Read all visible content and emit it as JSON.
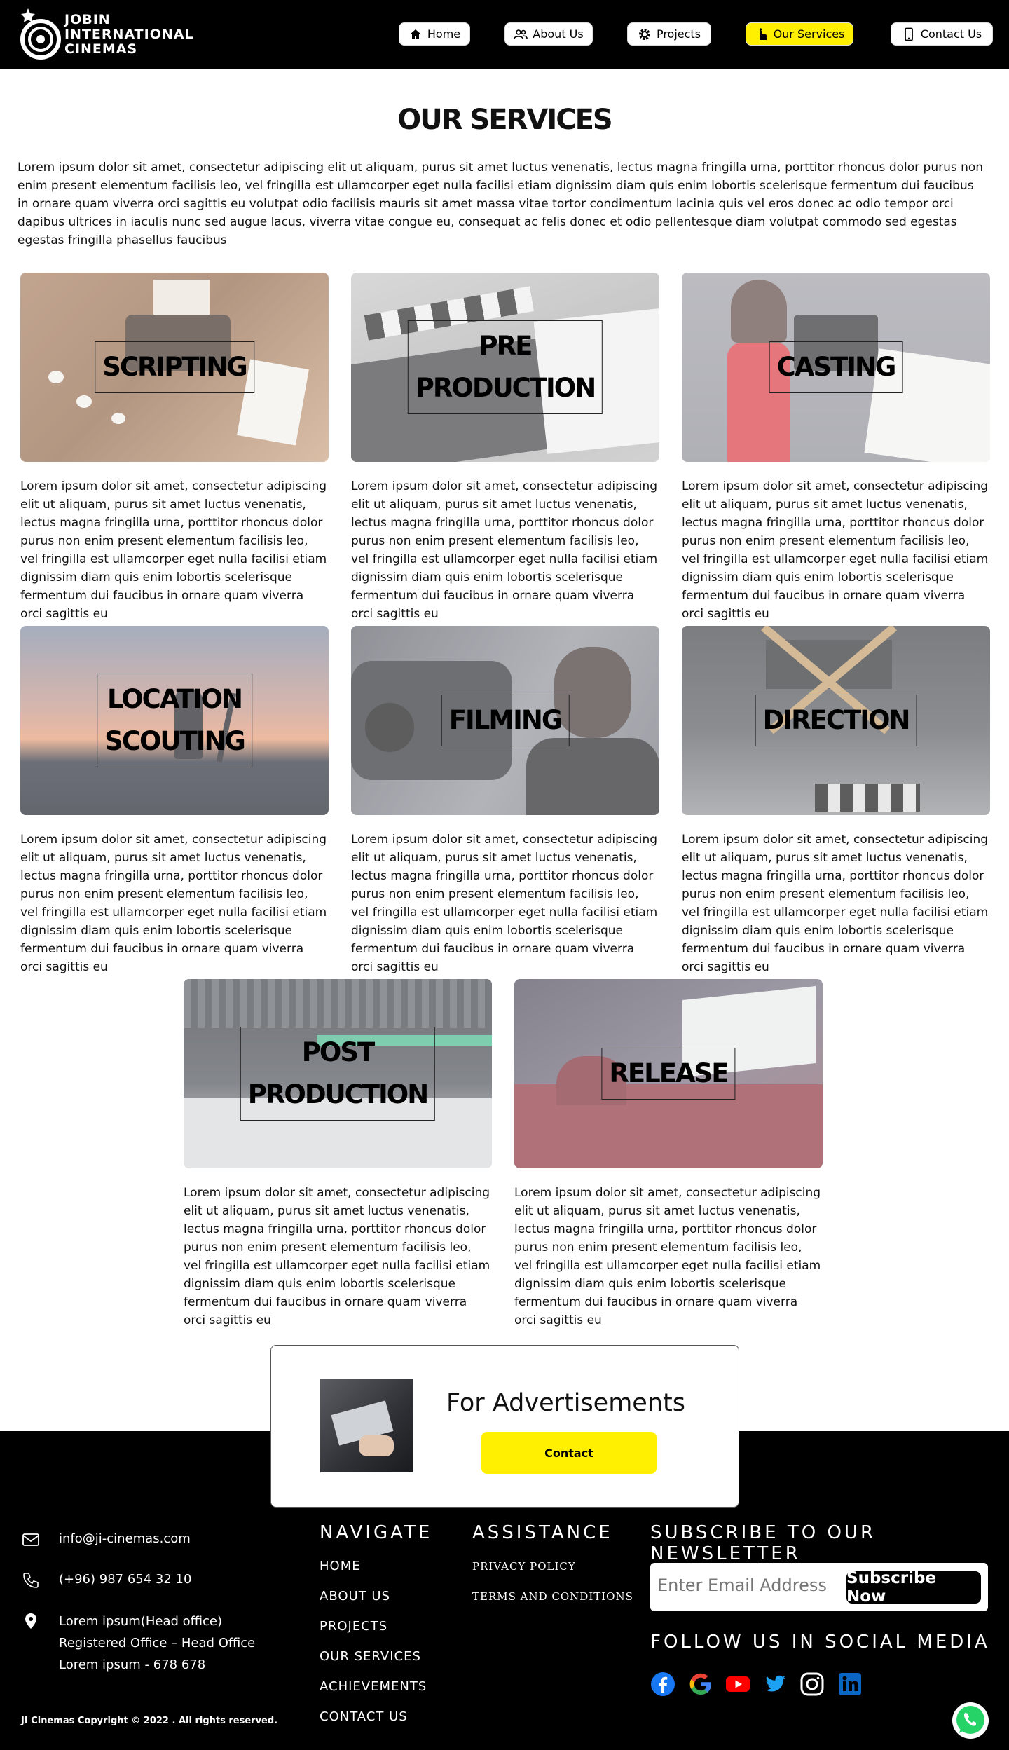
{
  "brand": {
    "lines": [
      "JOBIN",
      "INTERNATIONAL",
      "CINEMAS"
    ]
  },
  "nav": {
    "items": [
      {
        "label": "Home",
        "icon": "home-icon"
      },
      {
        "label": "About Us",
        "icon": "users-icon"
      },
      {
        "label": "Projects",
        "icon": "gear-icon"
      },
      {
        "label": "Our Services",
        "icon": "hand-icon",
        "active": true
      },
      {
        "label": "Contact Us",
        "icon": "phone-icon"
      }
    ],
    "active_color": "#ffef00"
  },
  "page": {
    "title": "OUR SERVICES",
    "intro": "Lorem ipsum dolor sit amet, consectetur adipiscing elit ut aliquam, purus sit amet luctus venenatis, lectus magna fringilla urna, porttitor rhoncus dolor purus non enim present elementum facilisis leo, vel fringilla est ullamcorper eget nulla facilisi etiam dignissim diam quis enim lobortis scelerisque fermentum dui faucibus in ornare quam viverra orci sagittis eu volutpat odio facilisis mauris sit amet massa vitae tortor condimentum lacinia quis vel eros donec ac odio tempor orci dapibus ultrices in iaculis nunc sed augue lacus, viverra vitae congue eu, consequat ac felis donec et odio pellentesque diam volutpat commodo sed egestas egestas fringilla phasellus faucibus"
  },
  "services": [
    {
      "label": "SCRIPTING",
      "text": "Lorem ipsum dolor sit amet, consectetur adipiscing elit ut aliquam, purus sit amet luctus venenatis, lectus magna fringilla urna, porttitor rhoncus dolor purus non enim present elementum facilisis leo, vel fringilla est ullamcorper eget nulla facilisi etiam dignissim diam quis enim lobortis scelerisque fermentum dui faucibus in ornare quam viverra orci sagittis eu"
    },
    {
      "label": "PRE PRODUCTION",
      "text": "Lorem ipsum dolor sit amet, consectetur adipiscing elit ut aliquam, purus sit amet luctus venenatis, lectus magna fringilla urna, porttitor rhoncus dolor purus non enim present elementum facilisis leo, vel fringilla est ullamcorper eget nulla facilisi etiam dignissim diam quis enim lobortis scelerisque fermentum dui faucibus in ornare quam viverra orci sagittis eu"
    },
    {
      "label": "CASTING",
      "text": "Lorem ipsum dolor sit amet, consectetur adipiscing elit ut aliquam, purus sit amet luctus venenatis, lectus magna fringilla urna, porttitor rhoncus dolor purus non enim present elementum facilisis leo, vel fringilla est ullamcorper eget nulla facilisi etiam dignissim diam quis enim lobortis scelerisque fermentum dui faucibus in ornare quam viverra orci sagittis eu"
    },
    {
      "label": "LOCATION\nSCOUTING",
      "text": "Lorem ipsum dolor sit amet, consectetur adipiscing elit ut aliquam, purus sit amet luctus venenatis, lectus magna fringilla urna, porttitor rhoncus dolor purus non enim present elementum facilisis leo, vel fringilla est ullamcorper eget nulla facilisi etiam dignissim diam quis enim lobortis scelerisque fermentum dui faucibus in ornare quam viverra orci sagittis eu"
    },
    {
      "label": "FILMING",
      "text": "Lorem ipsum dolor sit amet, consectetur adipiscing elit ut aliquam, purus sit amet luctus venenatis, lectus magna fringilla urna, porttitor rhoncus dolor purus non enim present elementum facilisis leo, vel fringilla est ullamcorper eget nulla facilisi etiam dignissim diam quis enim lobortis scelerisque fermentum dui faucibus in ornare quam viverra orci sagittis eu"
    },
    {
      "label": "DIRECTION",
      "text": "Lorem ipsum dolor sit amet, consectetur adipiscing elit ut aliquam, purus sit amet luctus venenatis, lectus magna fringilla urna, porttitor rhoncus dolor purus non enim present elementum facilisis leo, vel fringilla est ullamcorper eget nulla facilisi etiam dignissim diam quis enim lobortis scelerisque fermentum dui faucibus in ornare quam viverra orci sagittis eu"
    },
    {
      "label": "POST\nPRODUCTION",
      "text": "Lorem ipsum dolor sit amet, consectetur adipiscing elit ut aliquam, purus sit amet luctus venenatis, lectus magna fringilla urna, porttitor rhoncus dolor purus non enim present elementum facilisis leo, vel fringilla est ullamcorper eget nulla facilisi etiam dignissim diam quis enim lobortis scelerisque fermentum dui faucibus in ornare quam viverra orci sagittis eu"
    },
    {
      "label": "RELEASE",
      "text": "Lorem ipsum dolor sit amet, consectetur adipiscing elit ut aliquam, purus sit amet luctus venenatis, lectus magna fringilla urna, porttitor rhoncus dolor purus non enim present elementum facilisis leo, vel fringilla est ullamcorper eget nulla facilisi etiam dignissim diam quis enim lobortis scelerisque fermentum dui faucibus in ornare quam viverra orci sagittis eu"
    }
  ],
  "ad": {
    "title": "For Advertisements",
    "button": "Contact",
    "button_color": "#ffef00"
  },
  "contact": {
    "email": "info@ji-cinemas.com",
    "phone": "(+96) 987 654 32 10",
    "address": [
      "Lorem ipsum(Head office)",
      "Registered Office – Head Office",
      "Lorem ipsum - 678 678"
    ]
  },
  "navigate": {
    "heading": "NAVIGATE",
    "links": [
      "HOME",
      "ABOUT US",
      "PROJECTS",
      "OUR SERVICES",
      "ACHIEVEMENTS",
      "CONTACT US"
    ]
  },
  "assistance": {
    "heading": "ASSISTANCE",
    "links": [
      "PRIVACY POLICY",
      "TERMS AND CONDITIONS"
    ]
  },
  "newsletter": {
    "heading": "SUBSCRIBE TO OUR NEWSLETTER",
    "placeholder": "Enter Email Address",
    "button": "Subscribe Now"
  },
  "social": {
    "heading": "FOLLOW US IN SOCIAL MEDIA",
    "icons": [
      "facebook-icon",
      "google-icon",
      "youtube-icon",
      "twitter-icon",
      "instagram-icon",
      "linkedin-icon"
    ]
  },
  "copyright": "JI Cinemas Copyright © 2022 . All rights reserved."
}
